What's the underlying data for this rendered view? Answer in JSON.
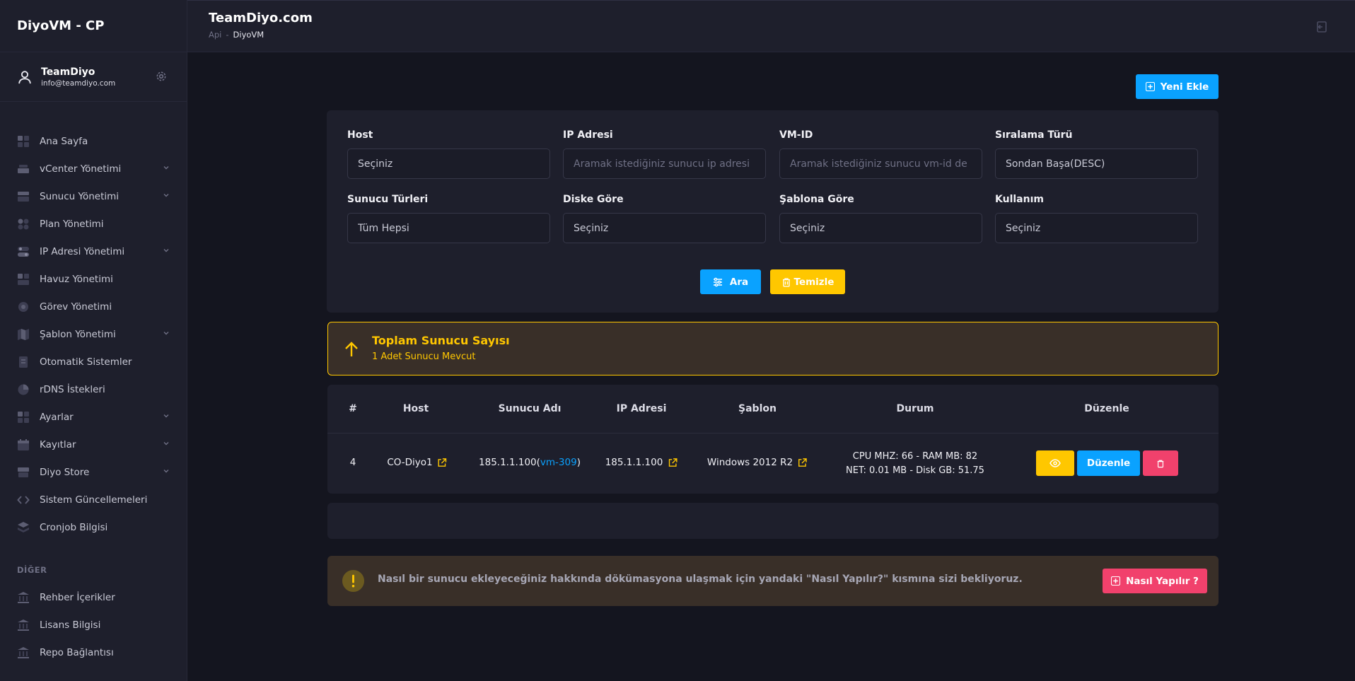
{
  "app": {
    "brand": "DiyoVM - CP"
  },
  "user": {
    "name": "TeamDiyo",
    "email": "info@teamdiyo.com"
  },
  "header": {
    "title": "TeamDiyo.com",
    "breadcrumb": [
      "Api",
      "DiyoVM"
    ]
  },
  "sidebar": {
    "items": [
      {
        "label": "Ana Sayfa",
        "icon": "dashboard-icon",
        "expandable": false
      },
      {
        "label": "vCenter Yönetimi",
        "icon": "server-icon",
        "expandable": true
      },
      {
        "label": "Sunucu Yönetimi",
        "icon": "layout-icon",
        "expandable": true
      },
      {
        "label": "Plan Yönetimi",
        "icon": "grid-dots-icon",
        "expandable": false
      },
      {
        "label": "IP Adresi Yönetimi",
        "icon": "toggle-icon",
        "expandable": true
      },
      {
        "label": "Havuz Yönetimi",
        "icon": "blocks-icon",
        "expandable": false
      },
      {
        "label": "Görev Yönetimi",
        "icon": "target-icon",
        "expandable": false
      },
      {
        "label": "Şablon Yönetimi",
        "icon": "map-icon",
        "expandable": true
      },
      {
        "label": "Otomatik Sistemler",
        "icon": "document-icon",
        "expandable": false
      },
      {
        "label": "rDNS İstekleri",
        "icon": "pie-icon",
        "expandable": false
      },
      {
        "label": "Ayarlar",
        "icon": "settings-grid-icon",
        "expandable": true
      },
      {
        "label": "Kayıtlar",
        "icon": "calendar-icon",
        "expandable": true
      },
      {
        "label": "Diyo Store",
        "icon": "store-icon",
        "expandable": true
      },
      {
        "label": "Sistem Güncellemeleri",
        "icon": "code-icon",
        "expandable": false
      },
      {
        "label": "Cronjob Bilgisi",
        "icon": "layers-icon",
        "expandable": false
      }
    ],
    "section_other": "DİĞER",
    "other_items": [
      {
        "label": "Rehber İçerikler",
        "icon": "bank-icon"
      },
      {
        "label": "Lisans Bilgisi",
        "icon": "bank-icon"
      },
      {
        "label": "Repo Bağlantısı",
        "icon": "bank-icon"
      }
    ]
  },
  "actions": {
    "add_label": "Yeni Ekle"
  },
  "filters": {
    "host": {
      "label": "Host",
      "value": "Seçiniz",
      "placeholder": ""
    },
    "ip": {
      "label": "IP Adresi",
      "value": "",
      "placeholder": "Aramak istediğiniz sunucu ip adresi"
    },
    "vmid": {
      "label": "VM-ID",
      "value": "",
      "placeholder": "Aramak istediğiniz sunucu vm-id de"
    },
    "sort": {
      "label": "Sıralama Türü",
      "value": "Sondan Başa(DESC)",
      "placeholder": ""
    },
    "types": {
      "label": "Sunucu Türleri",
      "value": "Tüm Hepsi",
      "placeholder": ""
    },
    "disk": {
      "label": "Diske Göre",
      "value": "Seçiniz",
      "placeholder": ""
    },
    "template": {
      "label": "Şablona Göre",
      "value": "Seçiniz",
      "placeholder": ""
    },
    "usage": {
      "label": "Kullanım",
      "value": "Seçiniz",
      "placeholder": ""
    },
    "search_label": "Ara",
    "clear_label": "Temizle"
  },
  "summary": {
    "title": "Toplam Sunucu Sayısı",
    "subtitle": "1 Adet Sunucu Mevcut"
  },
  "table": {
    "columns": [
      "#",
      "Host",
      "Sunucu Adı",
      "IP Adresi",
      "Şablon",
      "Durum",
      "Düzenle"
    ],
    "rows": [
      {
        "id": "4",
        "host": "CO-Diyo1",
        "name": "185.1.1.100",
        "vm_open": " (",
        "vm": "vm-309",
        "vm_close": ")",
        "ip": "185.1.1.100",
        "template": "Windows 2012 R2",
        "status_line1": "CPU MHZ: 66 - RAM MB: 82",
        "status_line2": "NET: 0.01 MB - Disk GB: 51.75",
        "edit_label": "Düzenle"
      }
    ]
  },
  "help": {
    "text": "Nasıl bir sunucu ekleyeceğiniz hakkında dökümasyona ulaşmak için yandaki \"Nasıl Yapılır?\" kısmına sizi bekliyoruz.",
    "button": "Nasıl Yapılır ?"
  },
  "colors": {
    "accent": "#0aa2ff",
    "warning": "#ffc700",
    "danger": "#f1416c",
    "sidebar": "#1e1f2c",
    "background": "#14151f"
  }
}
